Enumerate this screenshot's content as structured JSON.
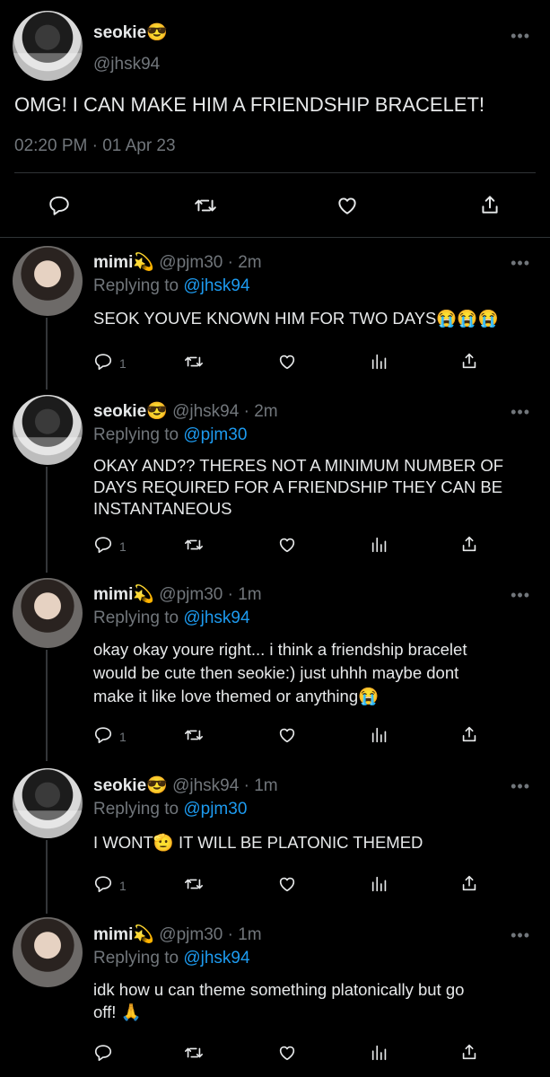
{
  "main_tweet": {
    "name": "seokie😎",
    "handle": "@jhsk94",
    "text": "OMG! I CAN MAKE HIM A FRIENDSHIP BRACELET!",
    "time": "02:20 PM",
    "sep": "·",
    "date": "01 Apr 23",
    "more": "•••"
  },
  "replies": [
    {
      "name": "mimi💫",
      "meta": "@pjm30 · 2m",
      "replying_prefix": "Replying to",
      "replying_to": "@jhsk94",
      "lines": [
        "SEOK YOUVE KNOWN HIM FOR TWO DAYS😭😭😭"
      ],
      "reply_count": "1",
      "more": "•••"
    },
    {
      "name": "seokie😎",
      "meta": "@jhsk94 · 2m",
      "replying_prefix": "Replying to",
      "replying_to": "@pjm30",
      "lines": [
        "OKAY AND?? THERES NOT A MINIMUM NUMBER OF",
        "DAYS REQUIRED FOR A FRIENDSHIP THEY CAN BE",
        "INSTANTANEOUS"
      ],
      "reply_count": "1",
      "more": "•••"
    },
    {
      "name": "mimi💫",
      "meta": "@pjm30 · 1m",
      "replying_prefix": "Replying to",
      "replying_to": "@jhsk94",
      "lines": [
        "okay okay youre right... i think a friendship bracelet",
        "would be cute then seokie:) just uhhh maybe dont",
        "make it like love themed or anything😭"
      ],
      "reply_count": "1",
      "more": "•••"
    },
    {
      "name": "seokie😎",
      "meta": "@jhsk94 · 1m",
      "replying_prefix": "Replying to",
      "replying_to": "@pjm30",
      "lines": [
        "I WONT🫡 IT WILL BE PLATONIC THEMED"
      ],
      "reply_count": "1",
      "more": "•••"
    },
    {
      "name": "mimi💫",
      "meta": "@pjm30 · 1m",
      "replying_prefix": "Replying to",
      "replying_to": "@jhsk94",
      "lines": [
        "idk how u can theme something platonically but go",
        "off! 🙏"
      ],
      "reply_count": "",
      "more": "•••"
    }
  ],
  "icons": {
    "reply": "reply-icon",
    "retweet": "retweet-icon",
    "like": "heart-icon",
    "views": "views-icon",
    "share": "share-icon"
  },
  "colors": {
    "background": "#000000",
    "text": "#e7e9ea",
    "muted": "#71767b",
    "link": "#1d9bf0",
    "divider": "#2f3336"
  }
}
